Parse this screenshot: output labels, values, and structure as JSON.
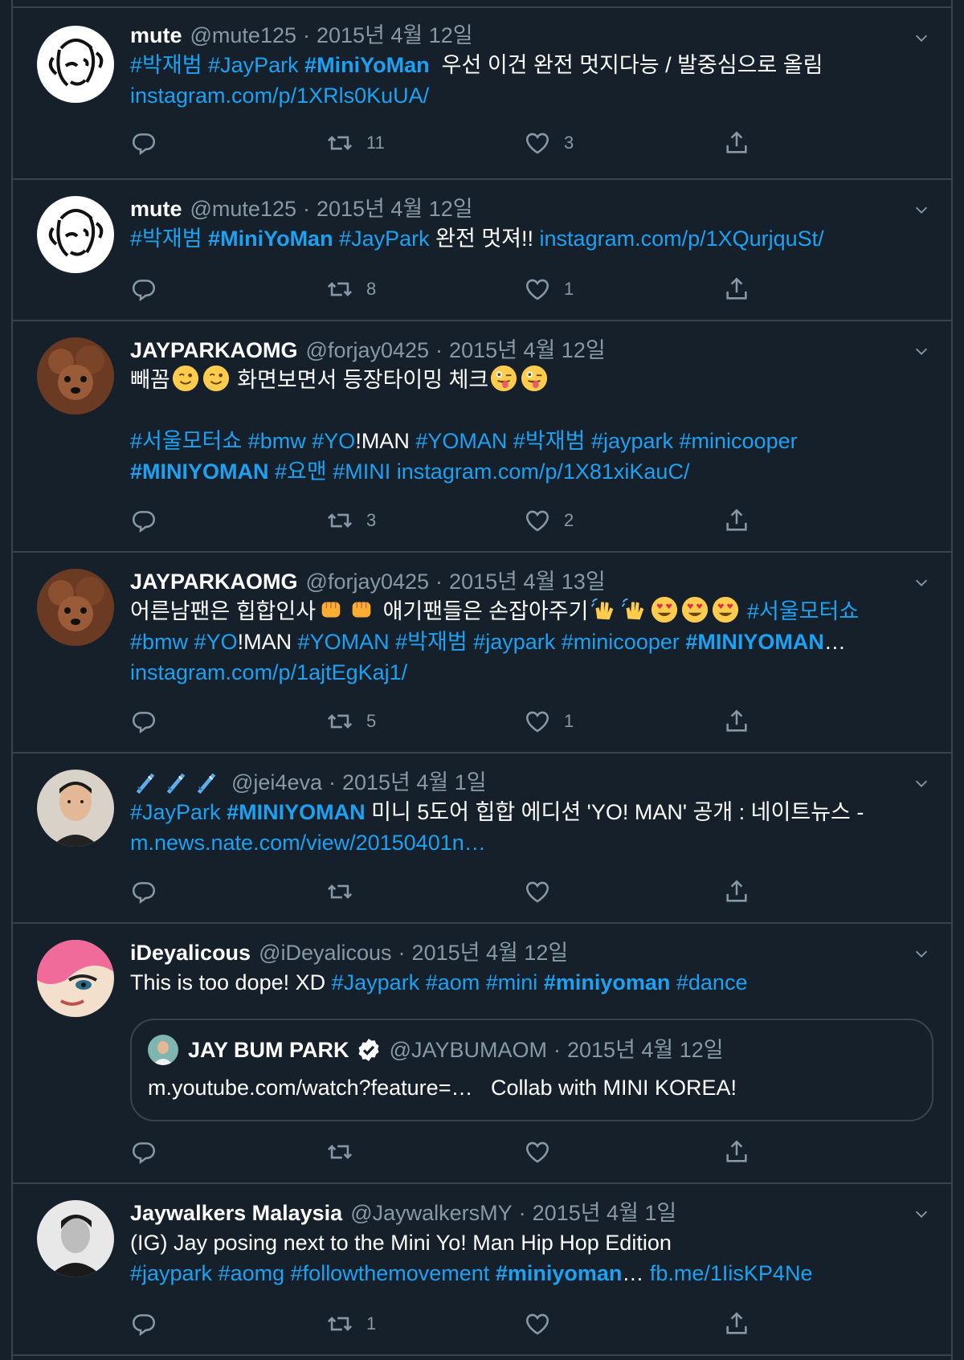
{
  "tweets": [
    {
      "name": "mute",
      "handle": "@mute125",
      "date": "2015년 4월 12일",
      "avatar": "sketch-face-avatar",
      "text": {
        "t1": "#박재범",
        "t2": "#JayPark",
        "t3": "#MiniYoMan",
        "t4": "  우선 이건 완전 멋지다능 / 발중심으로 올림",
        "t5": "instagram.com/p/1XRls0KuUA/"
      },
      "replies": "",
      "retweets": "11",
      "likes": "3"
    },
    {
      "name": "mute",
      "handle": "@mute125",
      "date": "2015년 4월 12일",
      "avatar": "sketch-face-avatar",
      "text": {
        "t1": "#박재범",
        "t2": "#MiniYoMan",
        "t3": "#JayPark",
        "t4": " 완전 멋져!! ",
        "t5": "instagram.com/p/1XQurjquSt/"
      },
      "replies": "",
      "retweets": "8",
      "likes": "1"
    },
    {
      "name": "JAYPARKAOMG",
      "handle": "@forjay0425",
      "date": "2015년 4월 12일",
      "avatar": "poodle-avatar",
      "text": {
        "t1": "빼꼼",
        "t2": " 화면보면서 등장타이밍 체크",
        "t3": "#서울모터쇼",
        "t4": "#bmw",
        "t5": "#YO",
        "t6": "!MAN ",
        "t7": "#YOMAN",
        "t8": "#박재범",
        "t9": "#jaypark",
        "t10": "#minicooper",
        "t11": "#MINIYOMAN",
        "t12": "#요맨",
        "t13": "#MINI",
        "t14": "instagram.com/p/1X81xiKauC/"
      },
      "replies": "",
      "retweets": "3",
      "likes": "2"
    },
    {
      "name": "JAYPARKAOMG",
      "handle": "@forjay0425",
      "date": "2015년 4월 13일",
      "avatar": "poodle-avatar",
      "text": {
        "t1": "어른남팬은 힙합인사",
        "t2": " 애기팬들은 손잡아주기",
        "t3": "#서울모터쇼",
        "t4": "#bmw",
        "t5": "#YO",
        "t6": "!MAN ",
        "t7": "#YOMAN",
        "t8": "#박재범",
        "t9": "#jaypark",
        "t10": "#minicooper",
        "t11": "#MINIYOMAN",
        "t12": "…",
        "t13": "instagram.com/p/1ajtEgKaj1/"
      },
      "replies": "",
      "retweets": "5",
      "likes": "1"
    },
    {
      "name": "",
      "handle": "@jei4eva",
      "date": "2015년 4월 1일",
      "avatar": "person-avatar",
      "text": {
        "t1": "#JayPark",
        "t2": "#MINIYOMAN",
        "t3": " 미니 5도어 힙합 에디션 'YO! MAN' 공개 : 네이트뉴스 - ",
        "t4": "m.news.nate.com/view/20150401n…"
      },
      "replies": "",
      "retweets": "",
      "likes": ""
    },
    {
      "name": "iDeyalicous",
      "handle": "@iDeyalicous",
      "date": "2015년 4월 12일",
      "avatar": "pink-hair-avatar",
      "text": {
        "t1": "This is too dope! XD ",
        "t2": "#Jaypark",
        "t3": "#aom",
        "t4": "#mini",
        "t5": "#miniyoman",
        "t6": "#dance"
      },
      "quote": {
        "name": "JAY BUM PARK",
        "handle": "@JAYBUMAOM",
        "date": "2015년 4월 12일",
        "text": "m.youtube.com/watch?feature=…   Collab with MINI KOREA!"
      },
      "replies": "",
      "retweets": "",
      "likes": ""
    },
    {
      "name": "Jaywalkers Malaysia",
      "handle": "@JaywalkersMY",
      "date": "2015년 4월 1일",
      "avatar": "bw-person-avatar",
      "text": {
        "t1": "(IG) Jay posing next to the Mini Yo! Man Hip Hop Edition",
        "t2": "#jaypark",
        "t3": "#aomg",
        "t4": "#followthemovement",
        "t5": "#miniyoman",
        "t6": "…",
        "t7": "fb.me/1IisKP4Ne"
      },
      "replies": "",
      "retweets": "1",
      "likes": ""
    }
  ],
  "sep": " · ",
  "colors": {
    "background": "#15202b",
    "link": "#1da1f2",
    "muted": "#8899a6",
    "border": "#38444d"
  }
}
